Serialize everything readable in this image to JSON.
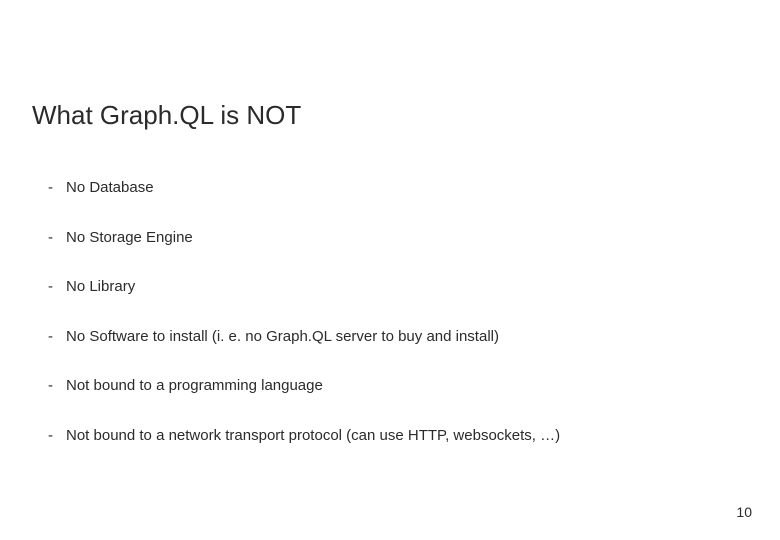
{
  "slide": {
    "title": "What Graph.QL is NOT",
    "bullets": [
      "No Database",
      "No Storage Engine",
      "No Library",
      "No Software to install (i. e. no Graph.QL server to buy and install)",
      "Not bound to a programming language",
      "Not bound to a network transport protocol (can use HTTP, websockets, …)"
    ],
    "page_number": "10"
  }
}
